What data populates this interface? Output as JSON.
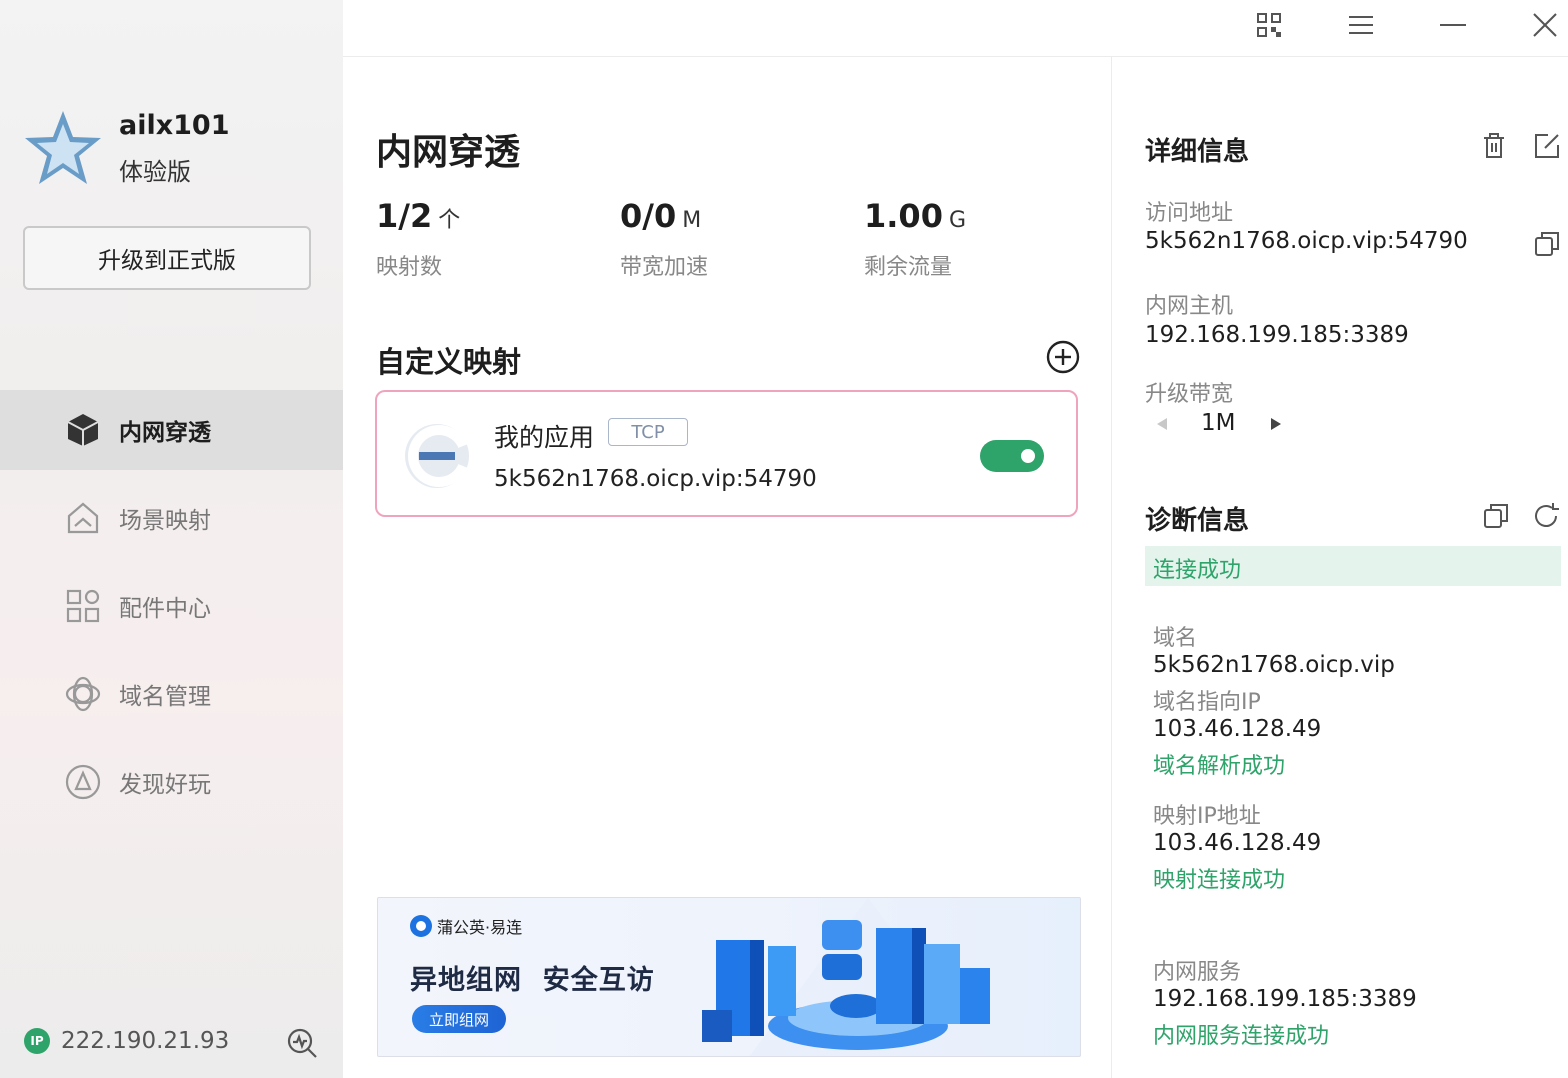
{
  "user": {
    "name": "ailx101",
    "plan": "体验版"
  },
  "sidebar": {
    "upgrade_label": "升级到正式版",
    "items": [
      {
        "label": "内网穿透",
        "icon": "cube-icon",
        "active": true
      },
      {
        "label": "场景映射",
        "icon": "home-icon",
        "active": false
      },
      {
        "label": "配件中心",
        "icon": "grid-icon",
        "active": false
      },
      {
        "label": "域名管理",
        "icon": "domain-icon",
        "active": false
      },
      {
        "label": "发现好玩",
        "icon": "compass-icon",
        "active": false
      }
    ],
    "ip_badge": "IP",
    "public_ip": "222.190.21.93"
  },
  "main": {
    "title": "内网穿透",
    "stats": [
      {
        "value": "1/2",
        "unit": "个",
        "label": "映射数"
      },
      {
        "value": "0/0",
        "unit": "M",
        "label": "带宽加速"
      },
      {
        "value": "1.00",
        "unit": "G",
        "label": "剩余流量"
      }
    ],
    "section_title": "自定义映射",
    "mapping": {
      "name": "我的应用",
      "protocol": "TCP",
      "address": "5k562n1768.oicp.vip:54790",
      "enabled": true
    },
    "banner": {
      "brand": "蒲公英·易连",
      "headline": "异地组网  安全互访",
      "cta": "立即组网"
    }
  },
  "details": {
    "title": "详细信息",
    "access_label": "访问地址",
    "access_value": "5k562n1768.oicp.vip:54790",
    "host_label": "内网主机",
    "host_value": "192.168.199.185:3389",
    "bandwidth_label": "升级带宽",
    "bandwidth_value": "1M"
  },
  "diagnostics": {
    "title": "诊断信息",
    "status": "连接成功",
    "domain_label": "域名",
    "domain_value": "5k562n1768.oicp.vip",
    "domain_ip_label": "域名指向IP",
    "domain_ip_value": "103.46.128.49",
    "domain_ok": "域名解析成功",
    "mapped_ip_label": "映射IP地址",
    "mapped_ip_value": "103.46.128.49",
    "mapped_ok": "映射连接成功",
    "service_label": "内网服务",
    "service_value": "192.168.199.185:3389",
    "service_ok": "内网服务连接成功"
  },
  "colors": {
    "accent": "#2ea36a",
    "card_border": "#f0a3bd",
    "active_nav": "#dedede"
  }
}
